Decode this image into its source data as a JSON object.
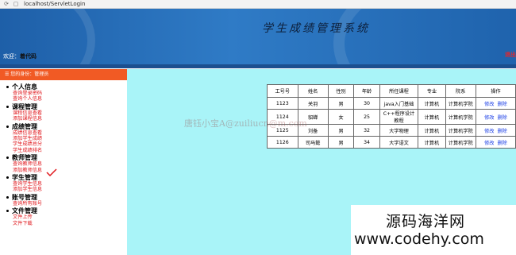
{
  "browser": {
    "url": "localhost/ServletLogin",
    "refresh_icon": "refresh-icon",
    "page_icon": "page-icon"
  },
  "banner": {
    "title": "学生成绩管理系统",
    "welcome_prefix": "欢迎：",
    "username": "着代码",
    "corner_mark": "退出"
  },
  "sidebar": {
    "header": "☰ 您的身份：管理员",
    "groups": [
      {
        "title": "个人信息",
        "items": [
          "查询登录密码",
          "查询个人信息"
        ]
      },
      {
        "title": "课程管理",
        "items": [
          "课程信息查看",
          "添加课程信息"
        ]
      },
      {
        "title": "成绩管理",
        "items": [
          "成绩信息查看",
          "添加学生成绩",
          "学生成绩总分",
          "学生成绩排名"
        ]
      },
      {
        "title": "教师管理",
        "items": [
          "查询教师信息",
          "添加教师信息"
        ]
      },
      {
        "title": "学生管理",
        "items": [
          "查询学生信息",
          "添加学生信息"
        ]
      },
      {
        "title": "账号管理",
        "items": [
          "查询所有账号"
        ]
      },
      {
        "title": "文件管理",
        "items": [
          "文件上传",
          "文件下载"
        ]
      }
    ]
  },
  "table": {
    "headers": [
      "工号号",
      "姓名",
      "性别",
      "年龄",
      "所任课程",
      "专业",
      "院系",
      "操作"
    ],
    "rows": [
      {
        "id": "1123",
        "name": "关羽",
        "gender": "男",
        "age": "30",
        "course": "java入门基础",
        "major": "计算机",
        "dept": "计算机学院",
        "edit": "修改",
        "delete": "删除"
      },
      {
        "id": "1124",
        "name": "貂蝉",
        "gender": "女",
        "age": "25",
        "course": "C++程序设计教程",
        "major": "计算机",
        "dept": "计算机学院",
        "edit": "修改",
        "delete": "删除"
      },
      {
        "id": "1125",
        "name": "刘备",
        "gender": "男",
        "age": "32",
        "course": "大学物理",
        "major": "计算机",
        "dept": "计算机学院",
        "edit": "修改",
        "delete": "删除"
      },
      {
        "id": "1126",
        "name": "司马懿",
        "gender": "男",
        "age": "34",
        "course": "大学语文",
        "major": "计算机",
        "dept": "计算机学院",
        "edit": "修改",
        "delete": "删除"
      }
    ]
  },
  "overlays": {
    "watermark": "唐钰小宝A@zuiliucn@m.com",
    "brand_line1": "源码海洋网",
    "brand_line2": "www.codehy.com"
  },
  "colors": {
    "banner": "#2f7bc6",
    "sidebar_header": "#f15a24",
    "menu_link": "#e0191e",
    "content_bg": "#a9f4f8",
    "action_link": "#1a3ee6"
  }
}
